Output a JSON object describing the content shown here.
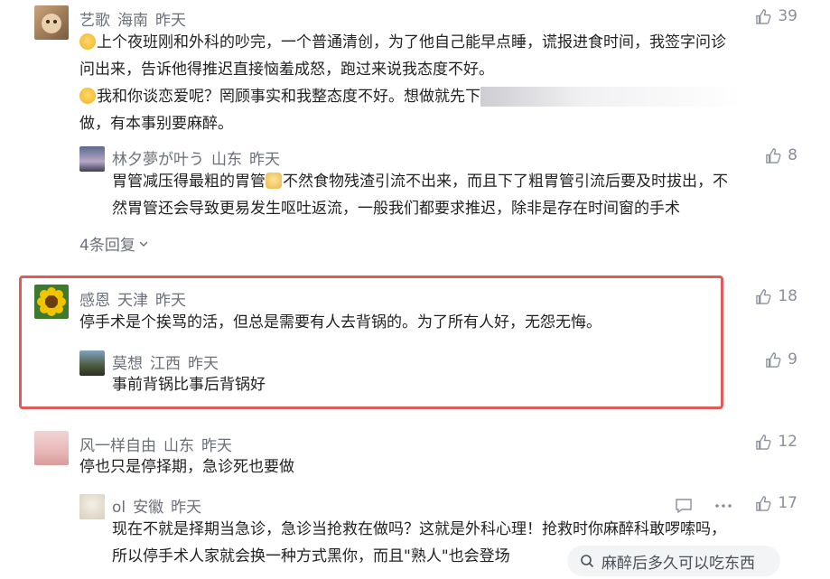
{
  "comments": [
    {
      "user": "艺歌",
      "location": "海南",
      "time": "昨天",
      "likes": "39",
      "line1": "上个夜班刚和外科的吵完，一个普通清创，为了他自己能早点睡，谎报进食时间，我签字问诊",
      "line2": "问出来，告诉他得推迟直接恼羞成怒，跑过来说我态度不好。",
      "line3": "我和你谈恋爱呢？罔顾事实和我整态度不好。想做就先下",
      "line4": "做，有本事别要麻醉。"
    },
    {
      "user": "林夕夢が叶う",
      "location": "山东",
      "time": "昨天",
      "likes": "8",
      "line1": "胃管减压得最粗的胃管",
      "line1b": "不然食物残渣引流不出来，而且下了粗胃管引流后要及时拔出，不",
      "line2": "然胃管还会导致更易发生呕吐返流，一般我们都要求推迟，除非是存在时间窗的手术"
    },
    {
      "user": "感恩",
      "location": "天津",
      "time": "昨天",
      "likes": "18",
      "line1": "停手术是个挨骂的活，但总是需要有人去背锅的。为了所有人好，无怨无悔。"
    },
    {
      "user": "莫想",
      "location": "江西",
      "time": "昨天",
      "likes": "9",
      "line1": "事前背锅比事后背锅好"
    },
    {
      "user": "风一样自由",
      "location": "山东",
      "time": "昨天",
      "likes": "12",
      "line1": "停也只是停择期，急诊死也要做"
    },
    {
      "user": "ol",
      "location": "安徽",
      "time": "昨天",
      "likes": "17",
      "line1": "现在不就是择期当急诊，急诊当抢救在做吗？这就是外科心理！抢救时你麻醉科敢啰嗦吗，",
      "line2": "所以停手术人家就会换一种方式黑你，而且\"熟人\"也会登场"
    }
  ],
  "replies_toggle": "4条回复",
  "search": {
    "text": "麻醉后多久可以吃东西"
  },
  "icons": {
    "like": "thumbs-up-icon",
    "reply": "comment-icon",
    "more": "more-dots-icon",
    "search": "search-icon",
    "chevron": "chevron-down-icon"
  },
  "colors": {
    "highlight_border": "#e35a5a",
    "meta": "#6b6f7a"
  }
}
